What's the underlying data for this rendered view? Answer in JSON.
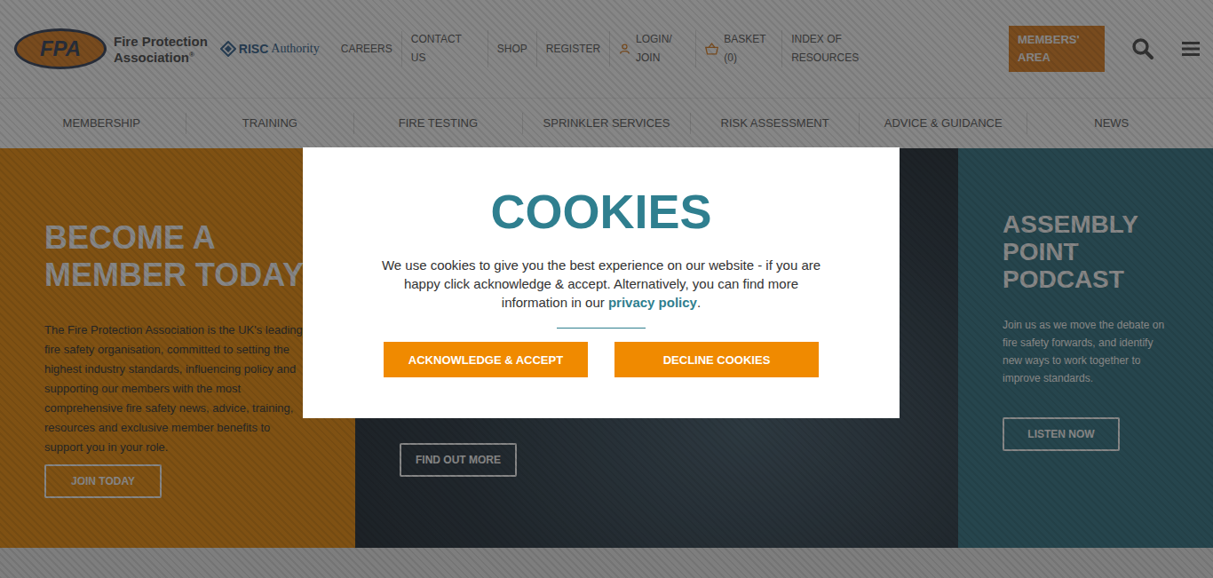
{
  "header": {
    "logo": {
      "badge": "FPA",
      "name_line1": "Fire Protection",
      "name_line2": "Association",
      "registered": "®"
    },
    "partner": {
      "bold": "RISC",
      "light": "Authority"
    },
    "links": [
      {
        "label": "CAREERS",
        "kind": "text"
      },
      {
        "label": "CONTACT US",
        "kind": "text"
      },
      {
        "label": "SHOP",
        "kind": "text"
      },
      {
        "label": "REGISTER",
        "kind": "text"
      },
      {
        "label": "LOGIN/ JOIN",
        "kind": "user"
      },
      {
        "label": "BASKET (0)",
        "kind": "basket"
      },
      {
        "label": "INDEX OF RESOURCES",
        "kind": "text"
      }
    ],
    "members_button": "MEMBERS' AREA"
  },
  "main_nav": [
    "MEMBERSHIP",
    "TRAINING",
    "FIRE TESTING",
    "SPRINKLER SERVICES",
    "RISK ASSESSMENT",
    "ADVICE & GUIDANCE",
    "NEWS"
  ],
  "hero": {
    "member": {
      "title": "BECOME A MEMBER TODAY",
      "text": "The Fire Protection Association is the UK's leading fire safety organisation, committed to setting the highest industry standards, influencing policy and supporting our members with the most comprehensive fire safety news, advice, training, resources and exclusive member benefits to support you in your role.",
      "button": "JOIN TODAY"
    },
    "feature": {
      "button": "FIND OUT MORE"
    },
    "podcast": {
      "title": "ASSEMBLY POINT PODCAST",
      "text": "Join us as we move the debate on fire safety forwards, and identify new ways to work together to improve standards.",
      "button": "LISTEN NOW"
    }
  },
  "cookie_modal": {
    "title": "COOKIES",
    "text": "We use cookies to give you the best experience on our website - if you are happy click acknowledge & accept. Alternatively, you can find more information in our",
    "link": "privacy policy",
    "link_end": ".",
    "buttons": [
      "ACKNOWLEDGE & ACCEPT",
      "DECLINE COOKIES"
    ]
  }
}
